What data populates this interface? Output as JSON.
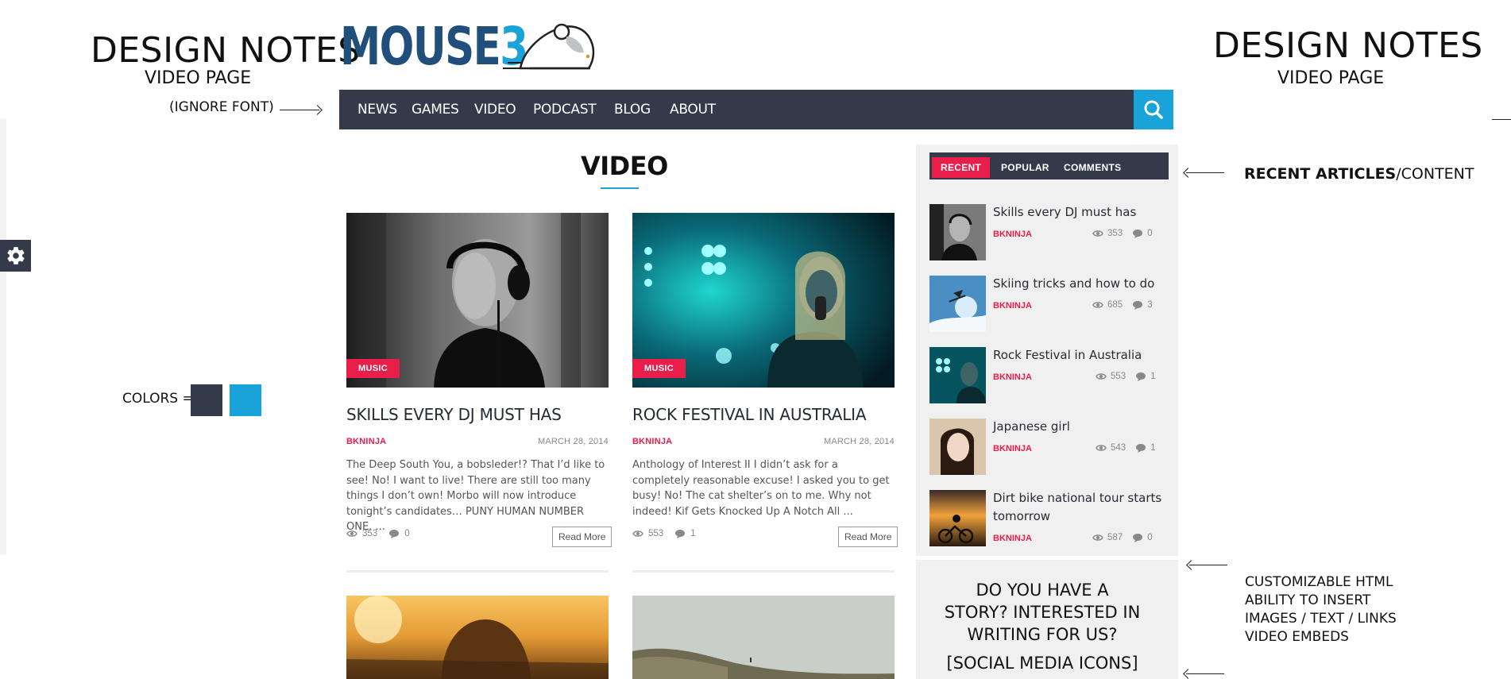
{
  "annotations": {
    "left_title": "DESIGN NOTES",
    "left_sub": "VIDEO PAGE",
    "right_title": "DESIGN NOTES",
    "right_sub": "VIDEO PAGE",
    "ignore_font": "(IGNORE FONT)",
    "colors_label": "COLORS =",
    "colors": [
      "#333a4a",
      "#1aa3d8"
    ],
    "recent_articles_a": "RECENT ARTICLES",
    "recent_articles_b": "/CONTENT",
    "customizable": [
      "CUSTOMIZABLE HTML",
      "ABILITY TO INSERT",
      "IMAGES / TEXT / LINKS",
      "VIDEO EMBEDS"
    ]
  },
  "logo": {
    "word": "MOUSE",
    "number": "3"
  },
  "nav": {
    "items": [
      "NEWS",
      "GAMES",
      "VIDEO",
      "PODCAST",
      "BLOG",
      "ABOUT"
    ],
    "search_icon": "search-icon"
  },
  "page": {
    "title": "VIDEO"
  },
  "cards": [
    {
      "tag": "MUSIC",
      "title": "SKILLS EVERY DJ MUST HAS",
      "author": "BKNINJA",
      "date": "MARCH 28, 2014",
      "excerpt": "The Deep South You, a bobsleder!? That I’d like to see! No! I want to live! There are still too many things I don’t own! Morbo will now introduce tonight’s candidates… PUNY HUMAN NUMBER ONE, ...",
      "views": "353",
      "comments": "0",
      "read_more": "Read More"
    },
    {
      "tag": "MUSIC",
      "title": "ROCK FESTIVAL IN AUSTRALIA",
      "author": "BKNINJA",
      "date": "MARCH 28, 2014",
      "excerpt": "Anthology of Interest II I didn’t ask for a completely reasonable excuse! I asked you to get busy! No! The cat shelter’s on to me. Why not indeed! Kif Gets Knocked Up A Notch All ...",
      "views": "553",
      "comments": "1",
      "read_more": "Read More"
    }
  ],
  "sidebar": {
    "tabs": [
      "RECENT",
      "POPULAR",
      "COMMENTS"
    ],
    "items": [
      {
        "title": "Skills every DJ must has",
        "author": "BKNINJA",
        "views": "353",
        "comments": "0"
      },
      {
        "title": "Skiing tricks and how to do",
        "author": "BKNINJA",
        "views": "685",
        "comments": "3"
      },
      {
        "title": "Rock Festival in Australia",
        "author": "BKNINJA",
        "views": "553",
        "comments": "1"
      },
      {
        "title": "Japanese girl",
        "author": "BKNINJA",
        "views": "543",
        "comments": "1"
      },
      {
        "title": "Dirt bike national tour starts tomorrow",
        "author": "BKNINJA",
        "views": "587",
        "comments": "0"
      }
    ],
    "cta": {
      "line1": "DO YOU HAVE A",
      "line2": "STORY? INTERESTED IN",
      "line3": "WRITING FOR US?",
      "social": "[SOCIAL MEDIA ICONS]"
    }
  }
}
